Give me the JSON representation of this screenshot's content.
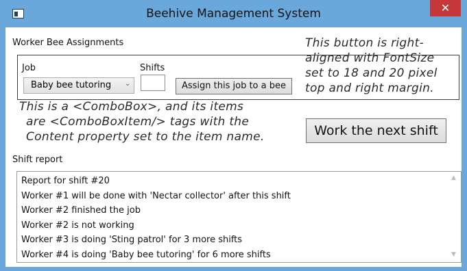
{
  "window": {
    "title": "Beehive Management System",
    "close_glyph": "✕"
  },
  "assignments": {
    "group_label": "Worker Bee Assignments",
    "job_label": "Job",
    "job_selected": "Baby bee tutoring",
    "shifts_label": "Shifts",
    "shifts_value": "",
    "assign_button": "Assign this job to a bee"
  },
  "work_button": "Work the next shift",
  "annotations": {
    "button_note": [
      "This button is right-",
      "aligned with FontSize",
      "set to 18 and 20 pixel",
      "top and right margin."
    ],
    "combo_note": [
      "This is a <ComboBox>, and its items",
      "are <ComboBoxItem/> tags with the",
      "Content property set to the item name."
    ]
  },
  "report": {
    "label": "Shift report",
    "lines": [
      "Report for shift #20",
      "Worker #1 will be done with 'Nectar collector' after this shift",
      "Worker #2 finished the job",
      "Worker #2 is not working",
      "Worker #3 is doing 'Sting patrol' for 3 more shifts",
      "Worker #4 is doing 'Baby bee tutoring' for 6 more shifts"
    ]
  },
  "colors": {
    "window_frame": "#6aa7db",
    "close_button": "#c7383b"
  }
}
